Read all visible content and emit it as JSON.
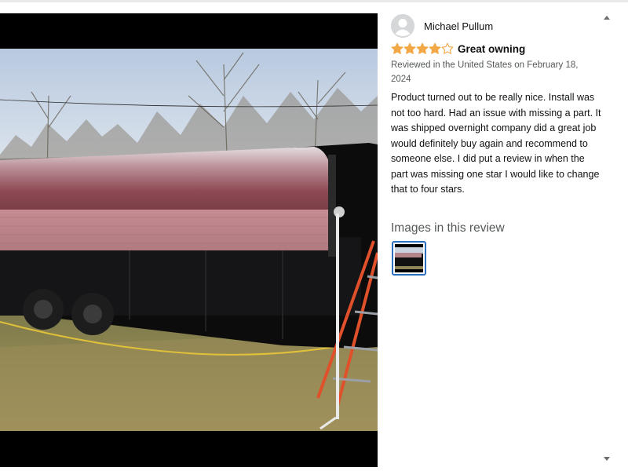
{
  "reviewer": {
    "name": "Michael Pullum",
    "avatar_icon": "user-avatar-icon"
  },
  "review": {
    "rating": 4,
    "rating_max": 5,
    "title": "Great owning",
    "date": "Reviewed in the United States on February 18, 2024",
    "body": "Product turned out to be really nice. Install was not too hard. Had an issue with missing a part. It was shipped overnight company did a great job would definitely buy again and recommend to someone else. I did put a review in when the part was missing one star I would like to change that to four stars."
  },
  "images_section": {
    "heading": "Images in this review",
    "thumbnail_count": 1
  },
  "colors": {
    "star": "#f3a847",
    "thumb_border": "#2f6fbf",
    "text": "#0f1111",
    "muted": "#565959"
  },
  "icons": {
    "scroll_up": "triangle-up-icon",
    "scroll_down": "triangle-down-icon"
  }
}
